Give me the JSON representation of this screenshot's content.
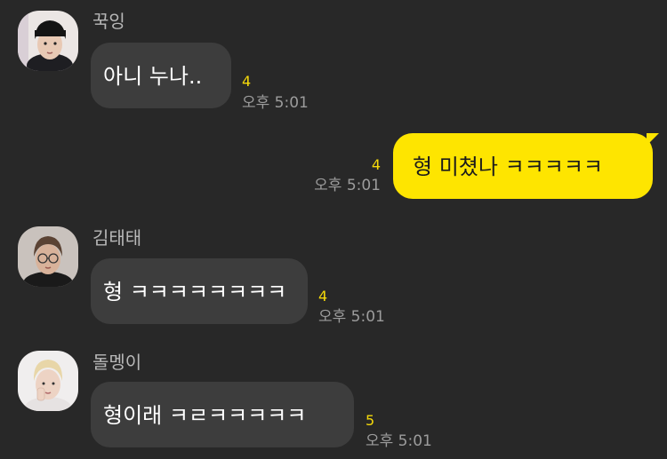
{
  "messages": [
    {
      "sender": "꾹잉",
      "text": "아니 누나..",
      "unread": "4",
      "time": "오후 5:01",
      "avatar": "profile-photo-dark-hair"
    },
    {
      "sender": "",
      "text": "형 미쳤나 ㅋㅋㅋㅋㅋ",
      "unread": "4",
      "time": "오후 5:01",
      "mine": true
    },
    {
      "sender": "김태태",
      "text": "형 ㅋㅋㅋㅋㅋㅋㅋㅋ",
      "unread": "4",
      "time": "오후 5:01",
      "avatar": "profile-photo-glasses"
    },
    {
      "sender": "돌멩이",
      "text": "형이래 ㅋㄹㅋㅋㅋㅋㅋ",
      "unread": "5",
      "time": "오후 5:01",
      "avatar": "profile-photo-blonde"
    }
  ],
  "colors": {
    "background": "#282828",
    "other_bubble": "#3d3d3d",
    "my_bubble": "#fee500",
    "unread_count": "#f5d90a",
    "timestamp": "#9c9c9c",
    "sender_name": "#b8b8b8"
  }
}
